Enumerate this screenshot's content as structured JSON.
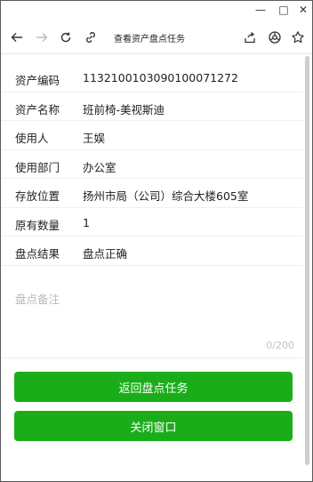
{
  "toolbar": {
    "title": "查看资产盘点任务",
    "icons": [
      "back-arrow-icon",
      "forward-arrow-icon",
      "refresh-icon",
      "link-icon",
      "share-icon",
      "browser-icon",
      "star-icon"
    ]
  },
  "window": {
    "minimize": "—",
    "maximize": "□",
    "close": "✕"
  },
  "fields": [
    {
      "label": "资产编码",
      "value": "113210010309010007127 2"
    },
    {
      "label": "资产名称",
      "value": "班前椅-美视斯迪"
    },
    {
      "label": "使用人",
      "value": "王娱"
    },
    {
      "label": "使用部门",
      "value": "办公室"
    },
    {
      "label": "存放位置",
      "value": "扬州市局（公司）综合大楼605室"
    },
    {
      "label": "原有数量",
      "value": "1"
    },
    {
      "label": "盘点结果",
      "value": "盘点正确"
    }
  ],
  "remark": {
    "placeholder": "盘点备注",
    "counter": "0/200"
  },
  "buttons": {
    "back": "返回盘点任务",
    "close": "关闭窗口"
  },
  "colors": {
    "primary": "#1aad19"
  }
}
